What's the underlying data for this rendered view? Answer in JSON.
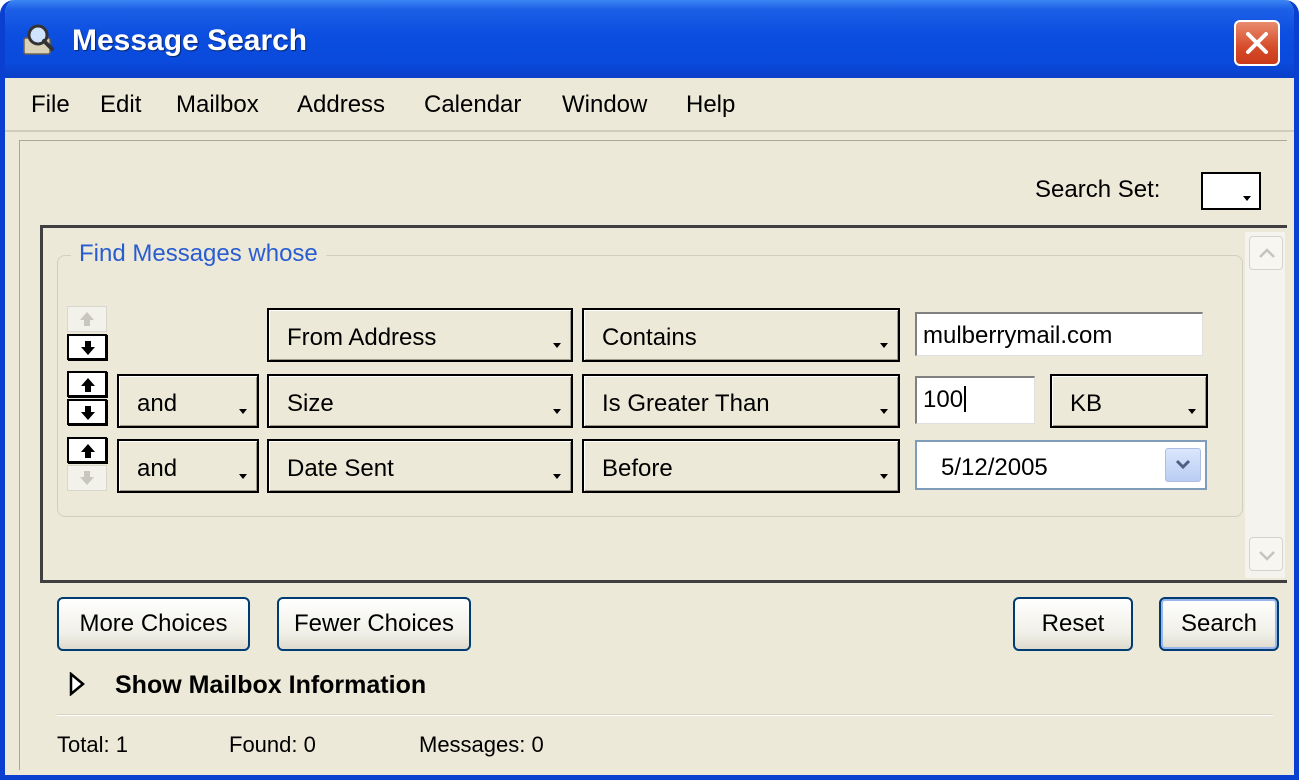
{
  "window": {
    "title": "Message Search"
  },
  "menu": [
    "File",
    "Edit",
    "Mailbox",
    "Address",
    "Calendar",
    "Window",
    "Help"
  ],
  "search_set": {
    "label": "Search Set:",
    "value": ""
  },
  "criteria": {
    "legend": "Find Messages whose",
    "rows": [
      {
        "conjunction": "",
        "field": "From Address",
        "operator": "Contains",
        "value": "mulberrymail.com"
      },
      {
        "conjunction": "and",
        "field": "Size",
        "operator": "Is Greater Than",
        "value": "100",
        "unit": "KB"
      },
      {
        "conjunction": "and",
        "field": "Date Sent",
        "operator": "Before",
        "value": "5/12/2005"
      }
    ]
  },
  "buttons": {
    "more": "More Choices",
    "fewer": "Fewer Choices",
    "reset": "Reset",
    "search": "Search"
  },
  "mailbox_info": {
    "label": "Show Mailbox Information"
  },
  "status": {
    "total": "Total: 1",
    "found": "Found: 0",
    "messages": "Messages: 0"
  },
  "colors": {
    "title_bar": "#0a4add",
    "window_bg": "#ece9d8",
    "legend_text": "#2a5cd1",
    "close_button": "#d64c2a"
  },
  "icons": [
    "search-window-icon",
    "close-icon",
    "move-up-arrow-icon",
    "move-down-arrow-icon",
    "dropdown-arrow-icon",
    "disclosure-triangle-icon"
  ]
}
